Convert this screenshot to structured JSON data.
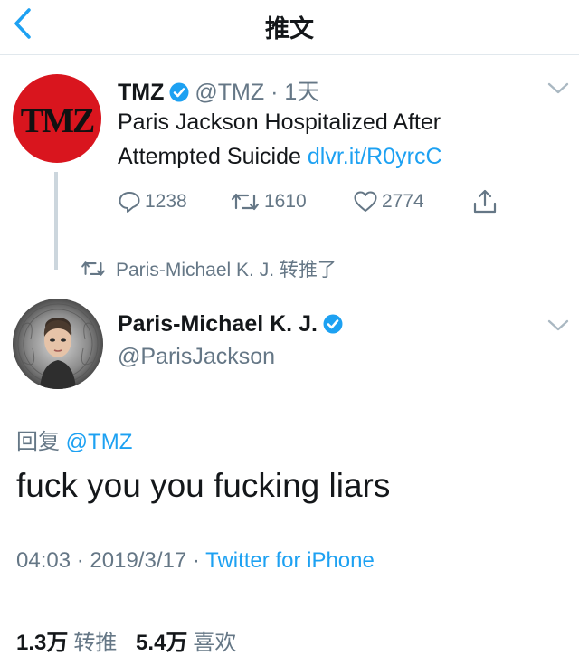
{
  "header": {
    "title": "推文",
    "back_icon": "chevron-left-icon"
  },
  "quoted_tweet": {
    "avatar_text": "TMZ",
    "name": "TMZ",
    "handle": "@TMZ",
    "time": "· 1天",
    "text": "Paris Jackson Hospitalized After Attempted Suicide",
    "link": "dlvr.it/R0yrcC",
    "replies": "1238",
    "retweets": "1610",
    "likes": "2774"
  },
  "retweet_context": "Paris-Michael K. J. 转推了",
  "main_tweet": {
    "name": "Paris-Michael K. J.",
    "handle": "@ParisJackson",
    "reply_prefix": "回复",
    "reply_handle": "@TMZ",
    "text": "fuck you you fucking liars",
    "time": "04:03",
    "date": "2019/3/17",
    "source": "Twitter for iPhone",
    "dot": "·"
  },
  "stats": {
    "retweets_count": "1.3万",
    "retweets_label": "转推",
    "likes_count": "5.4万",
    "likes_label": "喜欢"
  },
  "colors": {
    "accent": "#1da1f2",
    "muted": "#657786",
    "tmz_red": "#d9151e",
    "divider": "#e1e8ed"
  }
}
